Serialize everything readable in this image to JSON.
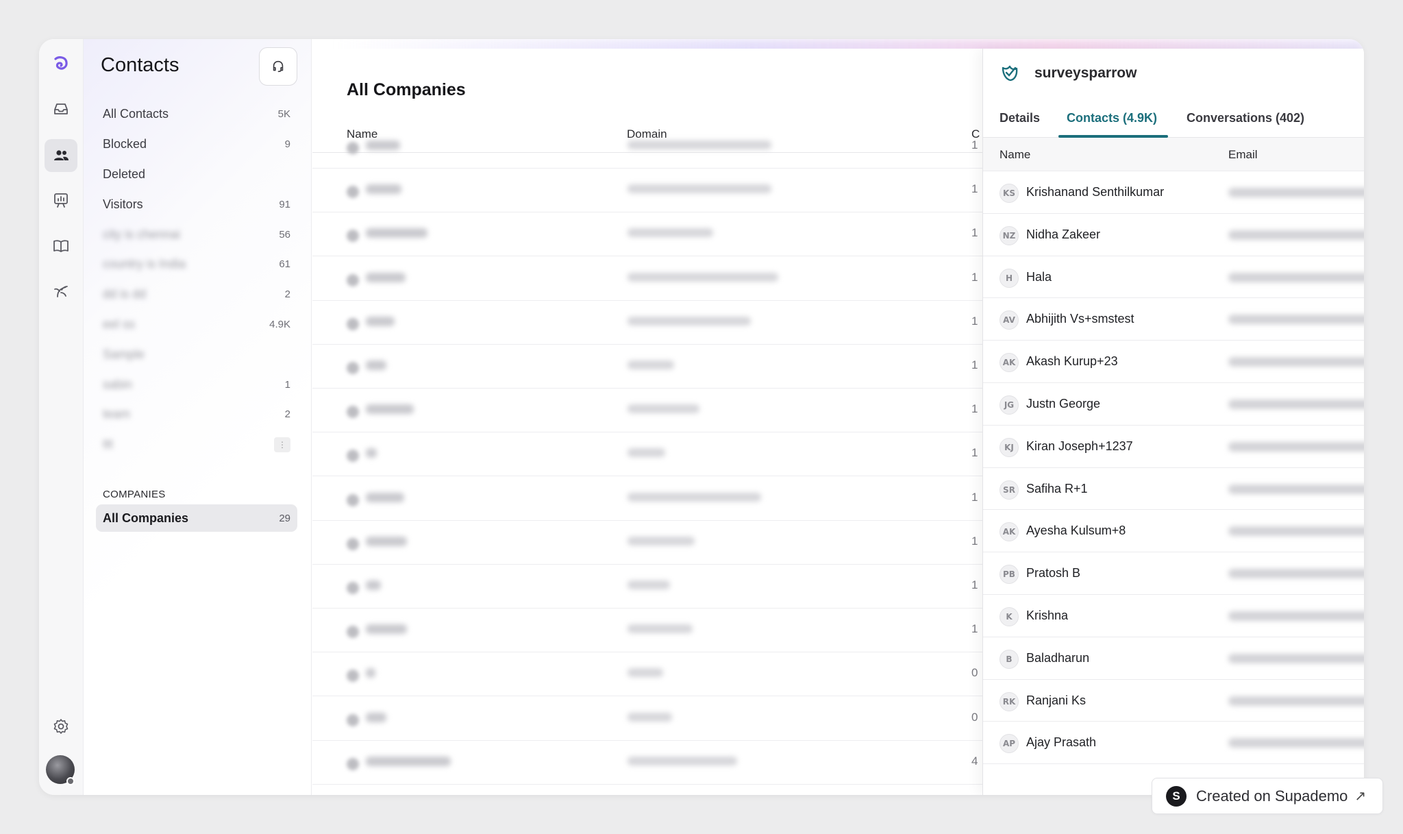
{
  "sidebar": {
    "title": "Contacts",
    "items": [
      {
        "label": "All Contacts",
        "count": "5K",
        "blurred": false
      },
      {
        "label": "Blocked",
        "count": "9",
        "blurred": false
      },
      {
        "label": "Deleted",
        "count": "",
        "blurred": false
      },
      {
        "label": "Visitors",
        "count": "91",
        "blurred": false
      },
      {
        "label": "city is chennai",
        "count": "56",
        "blurred": true
      },
      {
        "label": "country is India",
        "count": "61",
        "blurred": true
      },
      {
        "label": "dd is dd",
        "count": "2",
        "blurred": true
      },
      {
        "label": "eel ss",
        "count": "4.9K",
        "blurred": true
      },
      {
        "label": "Sample",
        "count": "",
        "blurred": true
      },
      {
        "label": "sabin",
        "count": "1",
        "blurred": true
      },
      {
        "label": "team",
        "count": "2",
        "blurred": true
      },
      {
        "label": "ttt",
        "count": "",
        "blurred": true
      }
    ],
    "companies_label": "COMPANIES",
    "companies_item": {
      "label": "All Companies",
      "count": "29"
    }
  },
  "main": {
    "title": "All Companies",
    "columns": {
      "name": "Name",
      "domain": "Domain",
      "contacts": "C"
    },
    "rows": [
      {
        "count": "1"
      },
      {
        "count": "1"
      },
      {
        "count": "1"
      },
      {
        "count": "1"
      },
      {
        "count": "1"
      },
      {
        "count": "1"
      },
      {
        "count": "1"
      },
      {
        "count": "1"
      },
      {
        "count": "1"
      },
      {
        "count": "1"
      },
      {
        "count": "1"
      },
      {
        "count": "1"
      },
      {
        "count": "0"
      },
      {
        "count": "0"
      },
      {
        "count": "4"
      }
    ]
  },
  "panel": {
    "company": "surveysparrow",
    "tabs": [
      "Details",
      "Contacts (4.9K)",
      "Conversations (402)"
    ],
    "active_tab": 1,
    "columns": {
      "name": "Name",
      "email": "Email"
    },
    "contacts": [
      {
        "initials": "KS",
        "name": "Krishanand Senthilkumar"
      },
      {
        "initials": "NZ",
        "name": "Nidha Zakeer"
      },
      {
        "initials": "H",
        "name": "Hala"
      },
      {
        "initials": "AV",
        "name": "Abhijith Vs+smstest"
      },
      {
        "initials": "AK",
        "name": "Akash Kurup+23"
      },
      {
        "initials": "JG",
        "name": "Justn George"
      },
      {
        "initials": "KJ",
        "name": "Kiran Joseph+1237"
      },
      {
        "initials": "SR",
        "name": "Safiha R+1"
      },
      {
        "initials": "AK",
        "name": "Ayesha Kulsum+8"
      },
      {
        "initials": "PB",
        "name": "Pratosh B"
      },
      {
        "initials": "K",
        "name": "Krishna"
      },
      {
        "initials": "B",
        "name": "Baladharun"
      },
      {
        "initials": "RK",
        "name": "Ranjani Ks"
      },
      {
        "initials": "AP",
        "name": "Ajay Prasath"
      }
    ],
    "close_icon": "×"
  },
  "badge": {
    "text": "Created on Supademo",
    "logo": "S",
    "arrow": "↗"
  },
  "colors": {
    "accent": "#1c6f7c",
    "brand": "#6b4fd8"
  }
}
